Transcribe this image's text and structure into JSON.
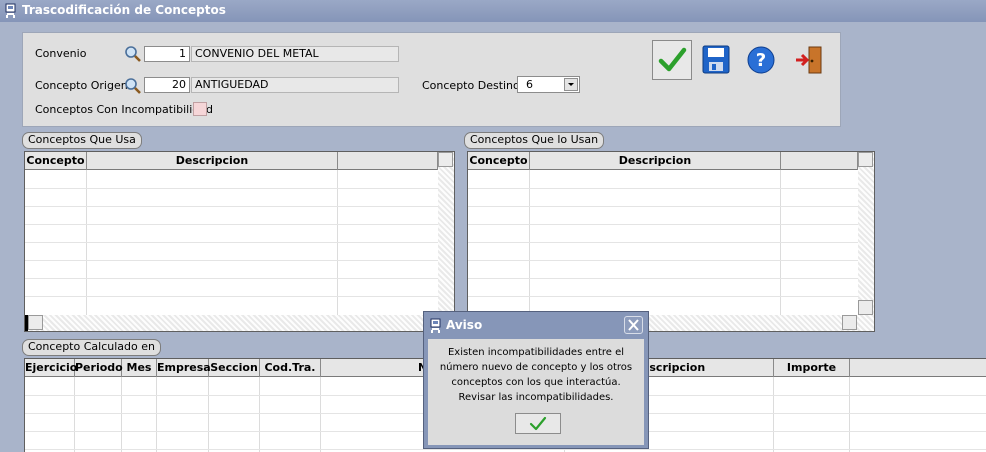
{
  "window": {
    "title": "Trascodificación de Conceptos"
  },
  "form": {
    "convenio_label": "Convenio",
    "convenio_code": "1",
    "convenio_name": "CONVENIO DEL METAL",
    "origen_label": "Concepto Origen:",
    "origen_code": "20",
    "origen_name": "ANTIGUEDAD",
    "destino_label": "Concepto Destino:",
    "destino_value": "6",
    "incompat_label": "Conceptos Con Incompatibilidad"
  },
  "toolbar": {
    "icons": [
      "ok-check-icon",
      "save-disk-icon",
      "help-icon",
      "exit-door-icon"
    ]
  },
  "grid_usa": {
    "title": "Conceptos Que Usa",
    "columns": [
      "Concepto",
      "Descripcion",
      ""
    ]
  },
  "grid_usan": {
    "title": "Conceptos Que lo Usan",
    "columns": [
      "Concepto",
      "Descripcion",
      ""
    ]
  },
  "grid_calc": {
    "title": "Concepto Calculado en",
    "columns": [
      "Ejercicio",
      "Periodo",
      "Mes",
      "Empresa",
      "Seccion",
      "Cod.Tra.",
      "Nombre",
      "Descripcion",
      "Importe"
    ]
  },
  "dialog": {
    "title": "Aviso",
    "lines": [
      "Existen incompatibilidades entre el",
      "número nuevo de concepto y los otros",
      "conceptos con los que interactúa.",
      "Revisar las incompatibilidades."
    ]
  },
  "colors": {
    "background": "#a9b4ca",
    "panel": "#dfdfdf",
    "titlebar": "#8595b8",
    "checkbox": "#f6d6d8"
  }
}
